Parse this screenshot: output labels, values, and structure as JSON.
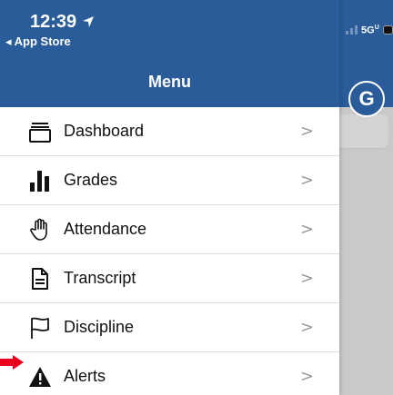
{
  "status_bar": {
    "time": "12:39",
    "back_app": "◂ App Store",
    "network": "5G",
    "network_superscript": "U"
  },
  "menu": {
    "title": "Menu",
    "items": [
      {
        "label": "Dashboard",
        "icon": "dashboard-stack-icon"
      },
      {
        "label": "Grades",
        "icon": "bar-chart-icon"
      },
      {
        "label": "Attendance",
        "icon": "raised-hand-icon"
      },
      {
        "label": "Transcript",
        "icon": "document-icon"
      },
      {
        "label": "Discipline",
        "icon": "flag-icon"
      },
      {
        "label": "Alerts",
        "icon": "warning-triangle-icon"
      }
    ],
    "chevron": ">"
  },
  "avatar": {
    "initial": "G"
  },
  "colors": {
    "header": "#2a5c9a",
    "annotation_arrow": "#e8001c"
  }
}
